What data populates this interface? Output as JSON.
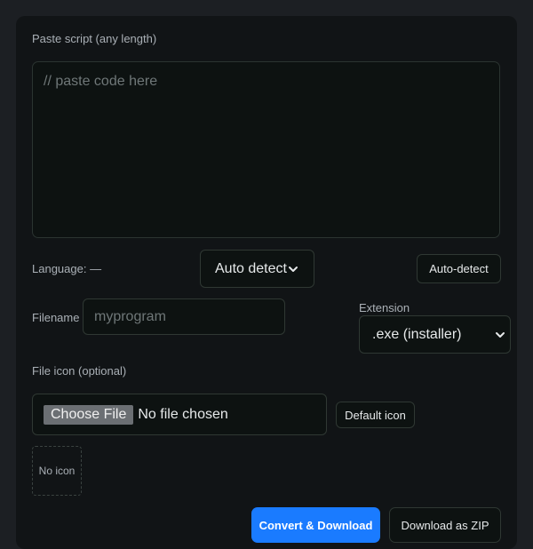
{
  "script": {
    "label": "Paste script (any length)",
    "placeholder": "// paste code here",
    "value": ""
  },
  "language": {
    "label": "Language: —",
    "select_value": "Auto detect",
    "detect_button": "Auto-detect"
  },
  "filename": {
    "label": "Filename",
    "placeholder": "myprogram"
  },
  "extension": {
    "label": "Extension",
    "select_value": ".exe (installer)"
  },
  "file_icon": {
    "label": "File icon (optional)",
    "choose_button": "Choose File",
    "status": "No file chosen",
    "default_button": "Default icon",
    "preview_text": "No icon"
  },
  "actions": {
    "primary_label": "Convert & Download",
    "secondary_label": "Download as ZIP"
  },
  "colors": {
    "accent": "#1a7bff",
    "panel": "#111416",
    "background": "#1c1f23"
  }
}
